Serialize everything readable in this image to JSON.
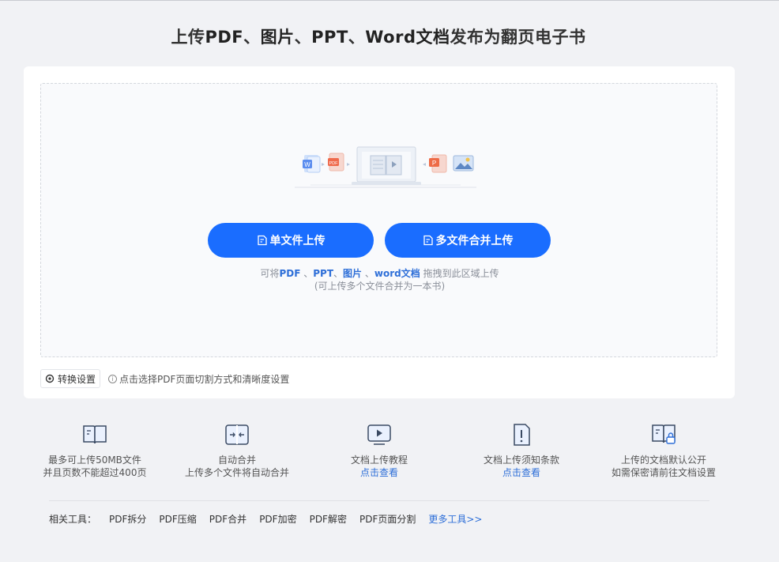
{
  "header": {
    "title_parts": [
      {
        "text": "上传",
        "bold": false
      },
      {
        "text": "PDF",
        "bold": true
      },
      {
        "text": "、",
        "bold": false
      },
      {
        "text": "图片",
        "bold": true
      },
      {
        "text": "、",
        "bold": false
      },
      {
        "text": "PPT",
        "bold": true
      },
      {
        "text": "、",
        "bold": false
      },
      {
        "text": "Word文档",
        "bold": true
      },
      {
        "text": "发布为翻页电子书",
        "bold": false
      }
    ]
  },
  "upload": {
    "single_label": "单文件上传",
    "multi_label": "多文件合并上传",
    "hint_prefix": "可将",
    "hint_pdf": "PDF",
    "hint_sep1": "、",
    "hint_ppt": "PPT",
    "hint_sep2": "、",
    "hint_img": "图片",
    "hint_sep3": "、",
    "hint_word": "word文档",
    "hint_suffix": "拖拽到此区域上传",
    "hint_line2": "(可上传多个文件合并为一本书)"
  },
  "settings": {
    "button_label": "转换设置",
    "hint": "点击选择PDF页面切割方式和清晰度设置",
    "info_glyph": "i"
  },
  "features": [
    {
      "icon": "book-icon",
      "line1": "最多可上传50MB文件",
      "line2": "并且页数不能超过400页"
    },
    {
      "icon": "merge-icon",
      "line1": "自动合并",
      "line2": "上传多个文件将自动合并"
    },
    {
      "icon": "video-tutorial-icon",
      "line1": "文档上传教程",
      "link": "点击查看"
    },
    {
      "icon": "notice-icon",
      "line1": "文档上传须知条款",
      "link": "点击查看"
    },
    {
      "icon": "public-lock-icon",
      "line1": "上传的文档默认公开",
      "line2": "如需保密请前往文档设置"
    }
  ],
  "tools": {
    "label": "相关工具：",
    "items": [
      "PDF拆分",
      "PDF压缩",
      "PDF合并",
      "PDF加密",
      "PDF解密",
      "PDF页面分割"
    ],
    "more": "更多工具>>"
  },
  "colors": {
    "accent": "#1a6dff",
    "link": "#2e6fd8",
    "background": "#f1f2f5"
  }
}
